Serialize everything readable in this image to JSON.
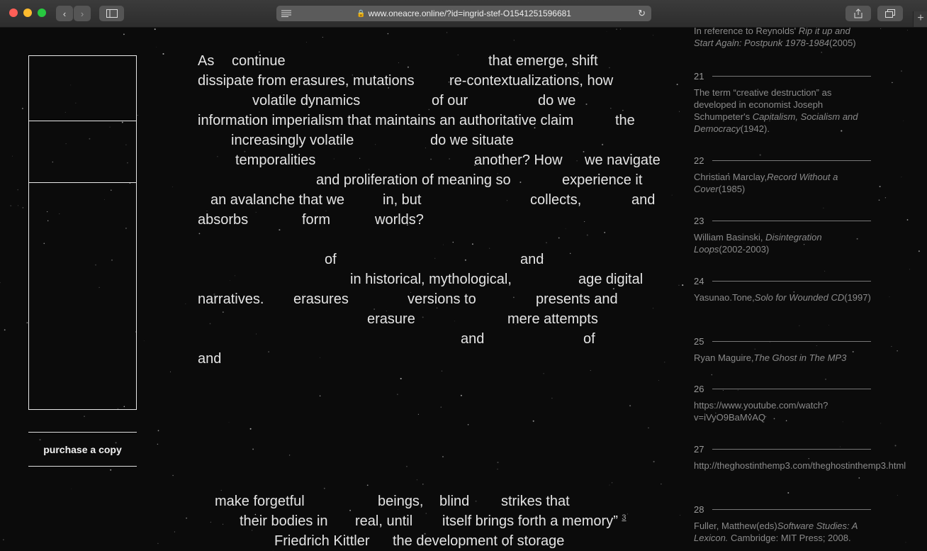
{
  "browser": {
    "url": "www.oneacre.online/?id=ingrid-stef-O1541251596681",
    "back_icon": "chevron-left-icon",
    "forward_icon": "chevron-right-icon"
  },
  "sidebar": {
    "purchase_label": "purchase a copy"
  },
  "main": {
    "lines": [
      [
        [
          "As",
          279
        ],
        [
          "continue",
          327
        ],
        [
          "that emerge, shift",
          689
        ]
      ],
      [
        [
          "dissipate from erasures, mutations",
          279
        ],
        [
          "re-contextualizations, how",
          634
        ]
      ],
      [
        [
          "volatile dynamics",
          356
        ],
        [
          "of our",
          609
        ],
        [
          "do we",
          759
        ]
      ],
      [
        [
          "information imperialism that maintains an authoritative claim",
          279
        ],
        [
          "the",
          868
        ]
      ],
      [
        [
          "increasingly volatile",
          326
        ],
        [
          "do we situate",
          607
        ]
      ],
      [
        [
          "temporalities",
          332
        ],
        [
          "another? How",
          669
        ],
        [
          "we navigate",
          825
        ]
      ],
      [
        [
          "and proliferation of meaning so",
          446
        ],
        [
          "experience it",
          793
        ]
      ],
      [
        [
          "an avalanche that we",
          297
        ],
        [
          "in, but",
          540
        ],
        [
          "collects,",
          748
        ],
        [
          "and",
          891
        ]
      ],
      [
        [
          "absorbs",
          279
        ],
        [
          "form",
          426
        ],
        [
          "worlds?",
          529
        ]
      ],
      [],
      [
        [
          "of",
          458
        ],
        [
          "and",
          734
        ]
      ],
      [
        [
          "in historical, mythological,",
          494
        ],
        [
          "age digital",
          816
        ]
      ],
      [
        [
          "narratives.",
          279
        ],
        [
          "erasures",
          414
        ],
        [
          "versions to",
          575
        ],
        [
          "presents and",
          756
        ]
      ],
      [
        [
          "erasure",
          518
        ],
        [
          "mere attempts",
          716
        ]
      ],
      [
        [
          "and",
          650
        ],
        [
          "of",
          823
        ]
      ],
      [
        [
          "and",
          279
        ]
      ]
    ],
    "quote_lines": [
      [
        [
          "make forgetful",
          303
        ],
        [
          "beings,",
          533
        ],
        [
          "blind",
          620
        ],
        [
          "strikes that",
          707
        ]
      ],
      [
        [
          "their bodies in",
          338
        ],
        [
          "real, until",
          501
        ],
        [
          "itself brings forth a memory”",
          624
        ]
      ],
      [
        [
          "Friedrich Kittler",
          387
        ],
        [
          "the development of storage",
          554
        ]
      ]
    ],
    "quote_footnote": "3"
  },
  "footnotes": [
    {
      "num": "",
      "parts": [
        [
          "In reference to Reynolds' ",
          ""
        ],
        [
          "Rip it up and Start Again: Postpunk 1978-1984",
          "i"
        ],
        [
          "(2005)",
          ""
        ]
      ]
    },
    {
      "num": "21",
      "parts": [
        [
          "The term “creative destruction” as developed in economist Joseph Schumpeter's ",
          ""
        ],
        [
          "Capitalism, Socialism and Democracy",
          "i"
        ],
        [
          "(1942).",
          ""
        ]
      ]
    },
    {
      "num": "22",
      "parts": [
        [
          "Christian Marclay,",
          ""
        ],
        [
          "Record Without a Cover",
          "i"
        ],
        [
          "(1985)",
          ""
        ]
      ]
    },
    {
      "num": "23",
      "parts": [
        [
          "William Basinski, ",
          ""
        ],
        [
          "Disintegration Loops",
          "i"
        ],
        [
          "(2002-2003)",
          ""
        ]
      ]
    },
    {
      "num": "24",
      "parts": [
        [
          "Yasunao.Tone,",
          ""
        ],
        [
          "Solo for Wounded CD",
          "i"
        ],
        [
          "(1997)",
          ""
        ]
      ]
    },
    {
      "num": "25",
      "parts": [
        [
          "Ryan Maguire,",
          ""
        ],
        [
          "The Ghost in The MP3",
          "i"
        ]
      ]
    },
    {
      "num": "26",
      "parts": [
        [
          "https://www.youtube.com/watch?v=iVyO9BaMvAQ",
          ""
        ]
      ]
    },
    {
      "num": "27",
      "parts": [
        [
          "http://theghostinthemp3.com/theghostinthemp3.html",
          ""
        ]
      ]
    },
    {
      "num": "28",
      "parts": [
        [
          "Fuller, Matthew(eds)",
          ""
        ],
        [
          "Software Studies: A Lexicon.",
          "i"
        ],
        [
          " Cambridge: MIT Press; 2008.",
          ""
        ]
      ]
    }
  ]
}
